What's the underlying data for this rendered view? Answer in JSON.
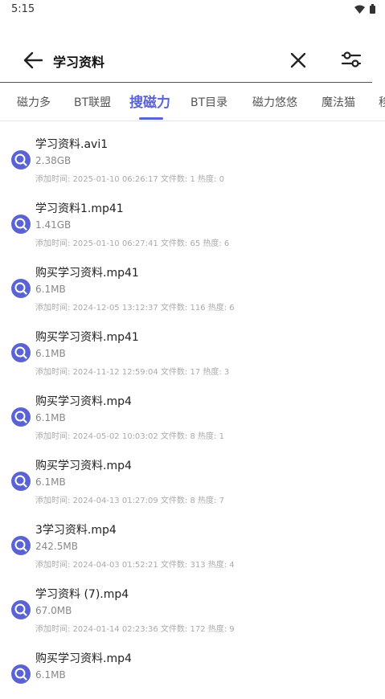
{
  "status": {
    "time": "5:15"
  },
  "search": {
    "query": "学习资料"
  },
  "tabs": [
    {
      "label": "磁力多",
      "active": false
    },
    {
      "label": "BT联盟",
      "active": false
    },
    {
      "label": "搜磁力",
      "active": true
    },
    {
      "label": "BT目录",
      "active": false
    },
    {
      "label": "磁力悠悠",
      "active": false
    },
    {
      "label": "魔法猫",
      "active": false
    },
    {
      "label": "移",
      "active": false
    }
  ],
  "colors": {
    "accent": "#5a63d6"
  },
  "results": [
    {
      "name": "学习资料.avi1",
      "size": "2.38GB",
      "meta": "添加时间: 2025-01-10 06:26:17  文件数: 1  热度: 0"
    },
    {
      "name": "学习资料1.mp41",
      "size": "1.41GB",
      "meta": "添加时间: 2025-01-10 06:27:41  文件数: 65  热度: 6"
    },
    {
      "name": "购买学习资料.mp41",
      "size": "6.1MB",
      "meta": "添加时间: 2024-12-05 13:12:37  文件数: 116  热度: 6"
    },
    {
      "name": "购买学习资料.mp41",
      "size": "6.1MB",
      "meta": "添加时间: 2024-11-12 12:59:04  文件数: 17  热度: 3"
    },
    {
      "name": "购买学习资料.mp4",
      "size": "6.1MB",
      "meta": "添加时间: 2024-05-02 10:03:02  文件数: 8  热度: 1"
    },
    {
      "name": "购买学习资料.mp4",
      "size": "6.1MB",
      "meta": "添加时间: 2024-04-13 01:27:09  文件数: 8  热度: 7"
    },
    {
      "name": "3学习资料.mp4",
      "size": "242.5MB",
      "meta": "添加时间: 2024-04-03 01:52:21  文件数: 313  热度: 4"
    },
    {
      "name": "学习资料 (7).mp4",
      "size": "67.0MB",
      "meta": "添加时间: 2024-01-14 02:23:36  文件数: 172  热度: 9"
    },
    {
      "name": "购买学习资料.mp4",
      "size": "6.1MB",
      "meta": ""
    }
  ]
}
